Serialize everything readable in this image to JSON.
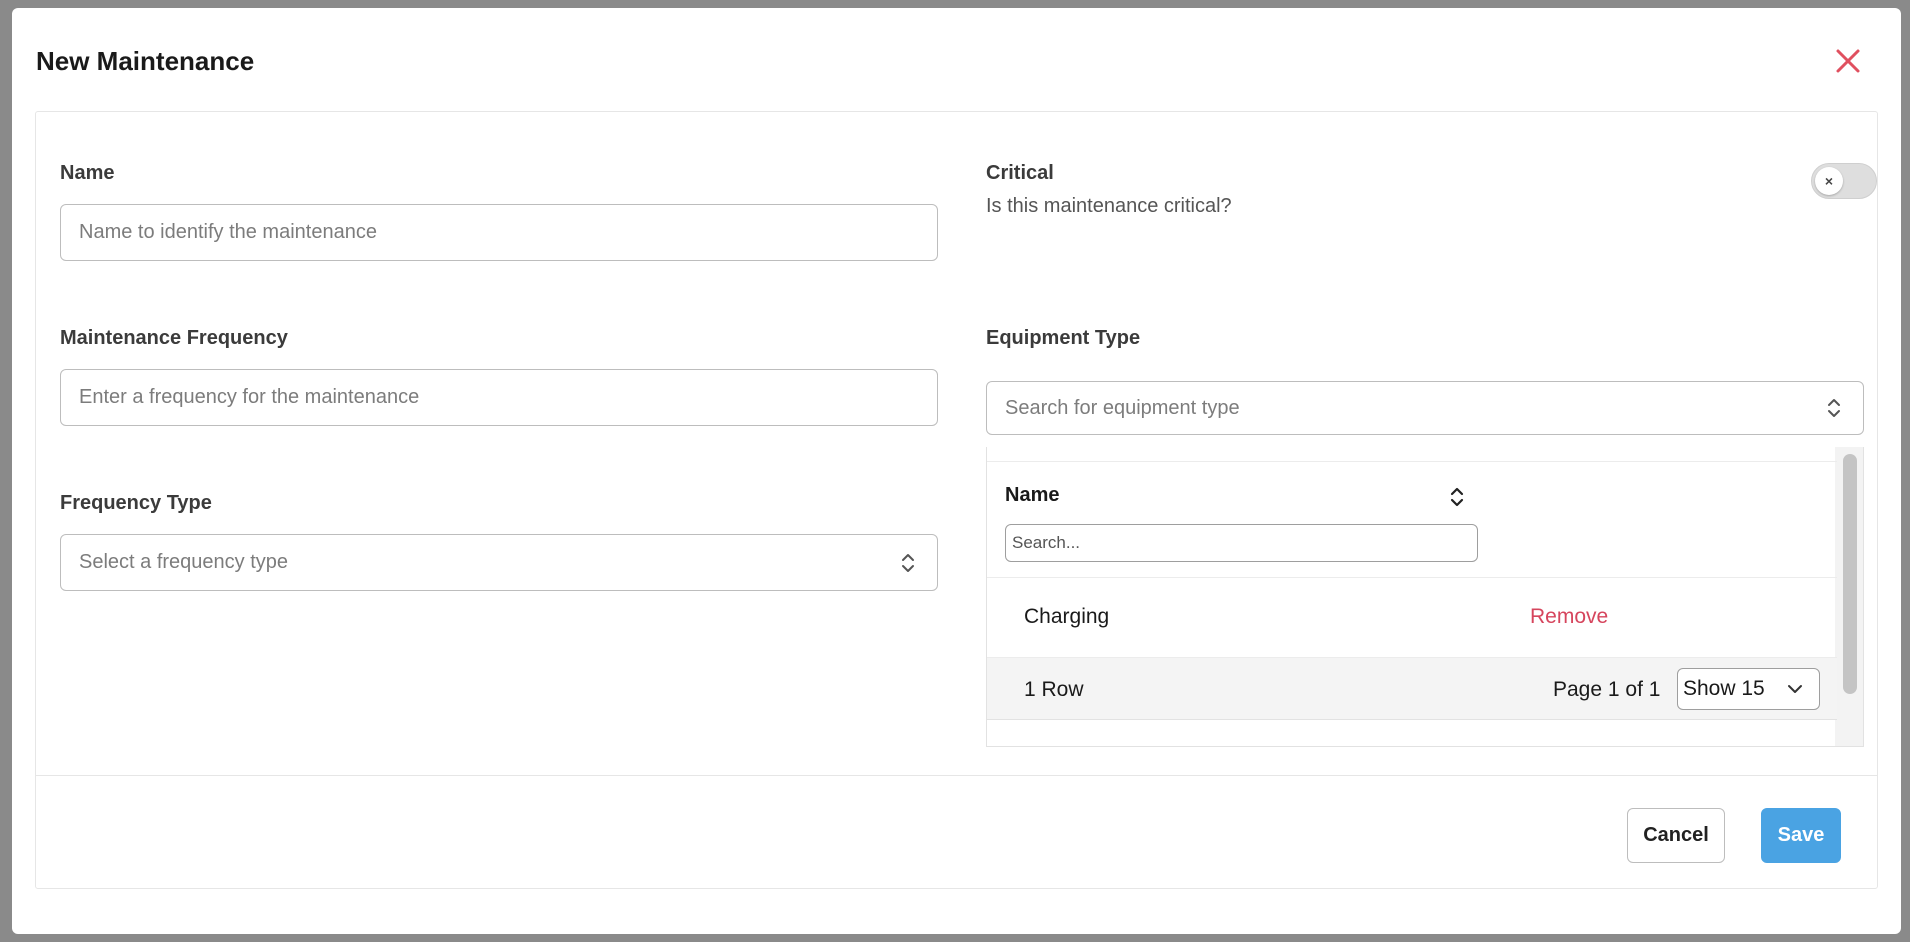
{
  "modal": {
    "title": "New Maintenance"
  },
  "form": {
    "name": {
      "label": "Name",
      "placeholder": "Name to identify the maintenance",
      "value": ""
    },
    "critical": {
      "label": "Critical",
      "description": "Is this maintenance critical?",
      "enabled": false,
      "knob_glyph": "×"
    },
    "frequency": {
      "label": "Maintenance Frequency",
      "placeholder": "Enter a frequency for the maintenance",
      "value": ""
    },
    "frequency_type": {
      "label": "Frequency Type",
      "placeholder": "Select a frequency type"
    },
    "equipment_type": {
      "label": "Equipment Type",
      "placeholder": "Search for equipment type",
      "table": {
        "column_header": "Name",
        "filter_placeholder": "Search...",
        "rows": [
          {
            "name": "Charging",
            "action": "Remove"
          }
        ],
        "row_count": "1 Row",
        "page_info": "Page 1 of 1",
        "page_size": "Show 15"
      }
    }
  },
  "footer": {
    "cancel_label": "Cancel",
    "save_label": "Save"
  },
  "colors": {
    "accent": "#4aa3e3",
    "danger": "#d6455d",
    "close_icon": "#e0505f"
  },
  "icons": {
    "close": "close-icon",
    "select": "chevron-up-down-icon",
    "sort": "sort-icon",
    "dropdown": "chevron-down-icon"
  }
}
